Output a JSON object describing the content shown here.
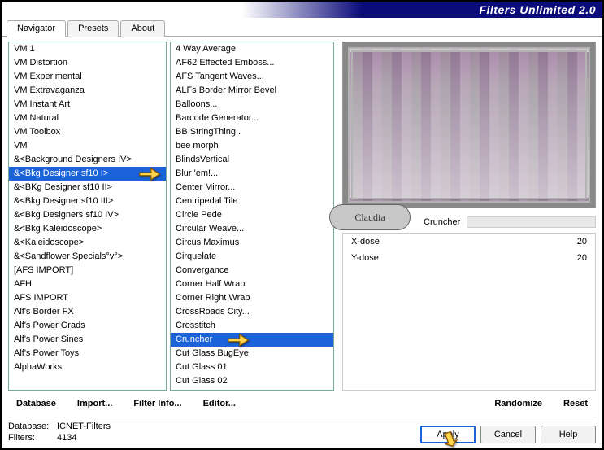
{
  "title": "Filters Unlimited 2.0",
  "tabs": [
    "Navigator",
    "Presets",
    "About"
  ],
  "active_tab": 0,
  "categories": [
    "VM 1",
    "VM Distortion",
    "VM Experimental",
    "VM Extravaganza",
    "VM Instant Art",
    "VM Natural",
    "VM Toolbox",
    "VM",
    "&<Background Designers IV>",
    "&<Bkg Designer sf10 I>",
    "&<BKg Designer sf10 II>",
    "&<Bkg Designer sf10 III>",
    "&<Bkg Designers sf10 IV>",
    "&<Bkg Kaleidoscope>",
    "&<Kaleidoscope>",
    "&<Sandflower Specials°v°>",
    "[AFS IMPORT]",
    "AFH",
    "AFS IMPORT",
    "Alf's Border FX",
    "Alf's Power Grads",
    "Alf's Power Sines",
    "Alf's Power Toys",
    "AlphaWorks"
  ],
  "categories_selected": 9,
  "filters": [
    "4 Way Average",
    "AF62 Effected Emboss...",
    "AFS Tangent Waves...",
    "ALFs Border Mirror Bevel",
    "Balloons...",
    "Barcode Generator...",
    "BB StringThing..",
    "bee morph",
    "BlindsVertical",
    "Blur 'em!...",
    "Center Mirror...",
    "Centripedal Tile",
    "Circle Pede",
    "Circular Weave...",
    "Circus Maximus",
    "Cirquelate",
    "Convergance",
    "Corner Half Wrap",
    "Corner Right Wrap",
    "CrossRoads City...",
    "Crosstitch",
    "Cruncher",
    "Cut Glass  BugEye",
    "Cut Glass 01",
    "Cut Glass 02"
  ],
  "filters_selected": 21,
  "preview_badge": "Claudia",
  "current_filter": "Cruncher",
  "params": [
    {
      "name": "X-dose",
      "value": "20"
    },
    {
      "name": "Y-dose",
      "value": "20"
    }
  ],
  "bottom_links": [
    "Database",
    "Import...",
    "Filter Info...",
    "Editor..."
  ],
  "bottom_right_links": [
    "Randomize",
    "Reset"
  ],
  "status": {
    "db_label": "Database:",
    "db_value": "ICNET-Filters",
    "filters_label": "Filters:",
    "filters_value": "4134"
  },
  "buttons": {
    "apply": "Apply",
    "cancel": "Cancel",
    "help": "Help"
  }
}
